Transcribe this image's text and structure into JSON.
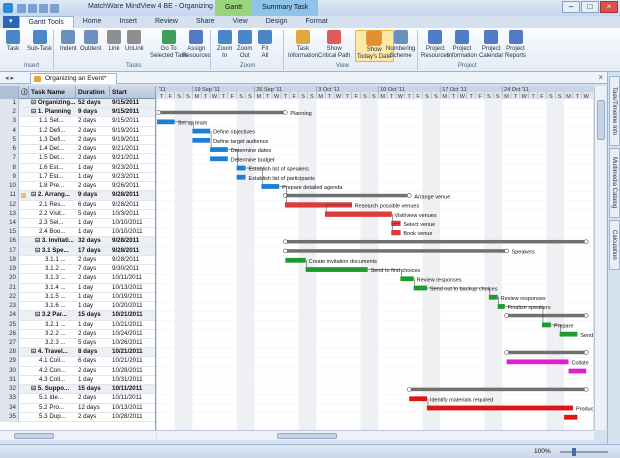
{
  "window": {
    "title": "MatchWare MindView 4 BE - Organizing an Event*",
    "context_tabs": [
      "Gantt",
      "Summary Task"
    ]
  },
  "ribbon_tabs": [
    "Gantt Tools",
    "Home",
    "Insert",
    "Review",
    "Share",
    "View",
    "Design",
    "Format"
  ],
  "ribbon": {
    "buttons": [
      {
        "label": "Task"
      },
      {
        "label": "Sub-Task"
      },
      {
        "label": "Indent"
      },
      {
        "label": "Outdent"
      },
      {
        "label": "Link"
      },
      {
        "label": "UnLink"
      },
      {
        "label": "Go To\nSelected Task"
      },
      {
        "label": "Assign\nResources"
      },
      {
        "label": "Zoom\nIn"
      },
      {
        "label": "Zoom\nOut"
      },
      {
        "label": "Fit\nAll"
      },
      {
        "label": "Task\nInformation"
      },
      {
        "label": "Show\nCritical Path"
      },
      {
        "label": "Show\nToday's Date"
      },
      {
        "label": "Numbering\nScheme"
      },
      {
        "label": "Project\nResources"
      },
      {
        "label": "Project\nInformation"
      },
      {
        "label": "Project\nCalendar"
      },
      {
        "label": "Project\nReports"
      }
    ],
    "groups": [
      "Insert",
      "Tasks",
      "Zoom",
      "View",
      "Project"
    ]
  },
  "document_tab": "Organizing an Event*",
  "table": {
    "headers": [
      "Task Name",
      "Duration",
      "Start"
    ],
    "rows": [
      {
        "num": "1",
        "name": "Organizing...",
        "dur": "52 days",
        "start": "9/15/2011",
        "summary": true
      },
      {
        "num": "2",
        "name": "1. Planning",
        "dur": "9 days",
        "start": "9/15/2011",
        "summary": true
      },
      {
        "num": "3",
        "name": "1.1 Set...",
        "dur": "2 days",
        "start": "9/15/2011"
      },
      {
        "num": "4",
        "name": "1.2 Defi...",
        "dur": "2 days",
        "start": "9/19/2011"
      },
      {
        "num": "5",
        "name": "1.3 Defi...",
        "dur": "2 days",
        "start": "9/19/2011"
      },
      {
        "num": "6",
        "name": "1.4 Det...",
        "dur": "2 days",
        "start": "9/21/2011"
      },
      {
        "num": "7",
        "name": "1.5 Det...",
        "dur": "2 days",
        "start": "9/21/2011"
      },
      {
        "num": "8",
        "name": "1.6 Est...",
        "dur": "1 day",
        "start": "9/23/2011"
      },
      {
        "num": "9",
        "name": "1.7 Est...",
        "dur": "1 day",
        "start": "9/23/2011"
      },
      {
        "num": "10",
        "name": "1.8 Pre...",
        "dur": "2 days",
        "start": "9/26/2011"
      },
      {
        "num": "11",
        "name": "2. Arrang...",
        "dur": "9 days",
        "start": "9/28/2011",
        "summary": true,
        "note": true
      },
      {
        "num": "12",
        "name": "2.1 Res...",
        "dur": "6 days",
        "start": "9/28/2011"
      },
      {
        "num": "13",
        "name": "2.2 Visit...",
        "dur": "5 days",
        "start": "10/3/2011"
      },
      {
        "num": "14",
        "name": "2.3 Sel...",
        "dur": "1 day",
        "start": "10/10/2011"
      },
      {
        "num": "15",
        "name": "2.4 Boo...",
        "dur": "1 day",
        "start": "10/10/2011"
      },
      {
        "num": "16",
        "name": "3. Invitati...",
        "dur": "32 days",
        "start": "9/28/2011",
        "summary": true
      },
      {
        "num": "17",
        "name": "3.1 Spe...",
        "dur": "17 days",
        "start": "9/28/2011",
        "summary": true
      },
      {
        "num": "18",
        "name": "3.1.1 ...",
        "dur": "2 days",
        "start": "9/28/2011"
      },
      {
        "num": "19",
        "name": "3.1.2 ...",
        "dur": "7 days",
        "start": "9/30/2011"
      },
      {
        "num": "20",
        "name": "3.1.3 ...",
        "dur": "2 days",
        "start": "10/11/2011"
      },
      {
        "num": "21",
        "name": "3.1.4 ...",
        "dur": "1 day",
        "start": "10/13/2011"
      },
      {
        "num": "22",
        "name": "3.1.5 ...",
        "dur": "1 day",
        "start": "10/19/2011"
      },
      {
        "num": "23",
        "name": "3.1.6 ...",
        "dur": "1 day",
        "start": "10/20/2011"
      },
      {
        "num": "24",
        "name": "3.2 Par...",
        "dur": "15 days",
        "start": "10/21/2011",
        "summary": true
      },
      {
        "num": "25",
        "name": "3.2.1 ...",
        "dur": "1 day",
        "start": "10/21/2011"
      },
      {
        "num": "26",
        "name": "3.2.2 ...",
        "dur": "2 days",
        "start": "10/24/2011"
      },
      {
        "num": "27",
        "name": "3.2.3 ...",
        "dur": "5 days",
        "start": "10/26/2011"
      },
      {
        "num": "28",
        "name": "4. Travel...",
        "dur": "8 days",
        "start": "10/21/2011",
        "summary": true
      },
      {
        "num": "29",
        "name": "4.1 Coll...",
        "dur": "6 days",
        "start": "10/21/2011"
      },
      {
        "num": "30",
        "name": "4.2 Con...",
        "dur": "2 days",
        "start": "10/28/2011"
      },
      {
        "num": "31",
        "name": "4.3 Coll...",
        "dur": "1 day",
        "start": "10/31/2011"
      },
      {
        "num": "32",
        "name": "5. Suppo...",
        "dur": "15 days",
        "start": "10/11/2011",
        "summary": true
      },
      {
        "num": "33",
        "name": "5.1 Ide...",
        "dur": "2 days",
        "start": "10/11/2011"
      },
      {
        "num": "34",
        "name": "5.2 Pro...",
        "dur": "12 days",
        "start": "10/13/2011"
      },
      {
        "num": "35",
        "name": "5.3 Dup...",
        "dur": "2 days",
        "start": "10/28/2011"
      }
    ]
  },
  "gantt": {
    "year_suffix": "'11",
    "week_labels": [
      "19 Sep '11",
      "26 Sep '11",
      "3 Oct '11",
      "10 Oct '11",
      "17 Oct '11",
      "24 Oct '11"
    ],
    "day_letters": [
      "T",
      "F",
      "S",
      "S",
      "M",
      "T",
      "W",
      "T",
      "F",
      "S",
      "S",
      "M",
      "T",
      "W",
      "T",
      "F",
      "S",
      "S",
      "M",
      "T",
      "W",
      "T",
      "F",
      "S",
      "S",
      "M",
      "T",
      "W",
      "T",
      "F",
      "S",
      "S",
      "M",
      "T",
      "W",
      "T",
      "F",
      "S",
      "S",
      "M",
      "T",
      "W",
      "T",
      "F",
      "S",
      "S",
      "M",
      "T",
      "W"
    ],
    "summary_labels": [
      "Planning",
      "Arrange venue",
      "Speakers"
    ],
    "colors": {
      "planning": "#1c7fd6",
      "venue": "#e03b3b",
      "speakers": "#1e9a2f",
      "travel": "#e01fd1",
      "support": "#e01414",
      "summary": "#707070"
    },
    "bar_labels": [
      {
        "row": 3,
        "text": "Set up team"
      },
      {
        "row": 4,
        "text": "Define objectives"
      },
      {
        "row": 5,
        "text": "Define target audience"
      },
      {
        "row": 6,
        "text": "Determine dates"
      },
      {
        "row": 7,
        "text": "Determine budget"
      },
      {
        "row": 8,
        "text": "Establish list of speakers"
      },
      {
        "row": 9,
        "text": "Establish list of participants"
      },
      {
        "row": 10,
        "text": "Prepare detailed agenda"
      },
      {
        "row": 12,
        "text": "Research possible venues"
      },
      {
        "row": 13,
        "text": "Visit/view venues"
      },
      {
        "row": 14,
        "text": "Select venue"
      },
      {
        "row": 15,
        "text": "Book venue"
      },
      {
        "row": 18,
        "text": "Create invitation documents"
      },
      {
        "row": 19,
        "text": "Send to first choices"
      },
      {
        "row": 20,
        "text": "Review responses"
      },
      {
        "row": 21,
        "text": "Send out to backup choices"
      },
      {
        "row": 22,
        "text": "Review responses"
      },
      {
        "row": 23,
        "text": "Finalize speakers"
      },
      {
        "row": 25,
        "text": "Prepare"
      },
      {
        "row": 26,
        "text": "Send out"
      },
      {
        "row": 29,
        "text": "Collate"
      },
      {
        "row": 33,
        "text": "Identify materials required"
      },
      {
        "row": 34,
        "text": "Produce a..."
      }
    ]
  },
  "side_tabs": [
    "Task/Timeline Info",
    "Multimedia Catalog",
    "Calculation"
  ],
  "status": {
    "zoom": "100%"
  }
}
